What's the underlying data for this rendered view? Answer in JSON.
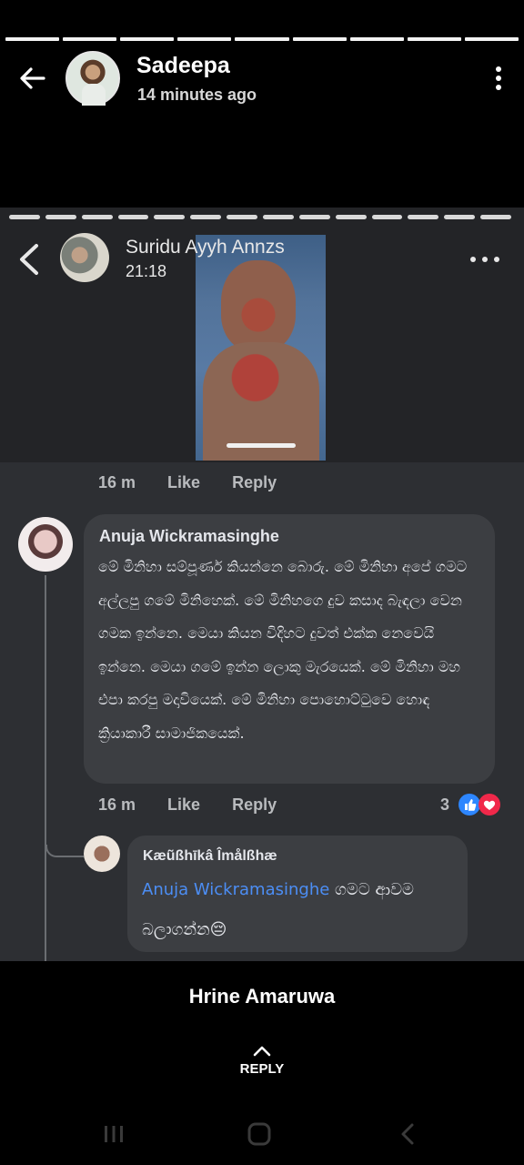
{
  "story": {
    "progress_segments": 9,
    "user_name": "Sadeepa",
    "posted_time": "14 minutes ago",
    "caption": "Hrine Amaruwa",
    "reply_label": "REPLY"
  },
  "shared_post": {
    "progress_segments": 14,
    "author": "Suridu Ayyh Annzs",
    "time": "21:18",
    "comment1_meta": {
      "time": "16 m",
      "like": "Like",
      "reply": "Reply"
    },
    "comment2": {
      "author": "Anuja Wickramasinghe",
      "text": "මේ මිනිහා සම්පූර්ණ කියන්නෙ බොරු. මේ මිනිහා අපේ ගමට අල්ලපු ගමේ මිනිහෙක්. මේ මිනිහගෙ දුව කසාද බැඳලා වෙන ගමක ඉන්නෙ. මෙයා කියන විදිහට දුවත් එක්ක නෙවෙයි ඉන්නෙ. මෙයා ගමේ ඉන්න ලොකු මැරයෙක්. මේ මිනිහා මහ එපා කරපු මදාවියෙක්. මේ මිනිහා පොහොට්ටුවෙ හොඳ ක්‍රියාකාරී සාමාජිකයෙක්.",
      "meta": {
        "time": "16 m",
        "like": "Like",
        "reply": "Reply"
      },
      "reaction_count": "3"
    },
    "reply": {
      "author": "Kæũßhīkâ Îmålßhæ",
      "mention": "Anuja Wickramasinghe",
      "text": " ගමට ආවම බලාගන්න😔"
    }
  },
  "colors": {
    "background": "#000000",
    "bubble": "#3c3e42",
    "mention": "#4c8ef5",
    "like": "#2d86ff",
    "love": "#f0284a"
  },
  "icons": {
    "back": "arrow-left-icon",
    "more": "more-vertical-icon",
    "inner_back": "chevron-left-icon",
    "inner_more": "more-horizontal-icon",
    "reply": "chevron-up-icon",
    "nav_recents": "recent-apps-icon",
    "nav_home": "home-icon",
    "nav_back": "nav-back-icon"
  }
}
